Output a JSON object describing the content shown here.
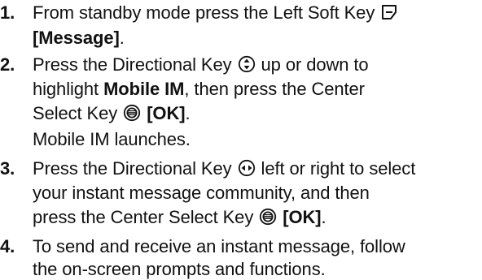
{
  "steps": [
    {
      "number": "1.",
      "line1_text": "From standby mode press the Left Soft Key",
      "line2_bold": "[Message]",
      "line2_text": "."
    },
    {
      "number": "2.",
      "line1_text": "Press the Directional Key",
      "line1_text_after": "up or down to",
      "line2_text": "highlight",
      "line2_bold": "Mobile IM",
      "line2_text_after": ", then press the Center",
      "line3_text": "Select Key",
      "line3_bold": "[OK]",
      "line3_text_after": ".",
      "note": "Mobile IM launches."
    },
    {
      "number": "3.",
      "line1_text": "Press the Directional Key",
      "line1_text_after": "left or right to select",
      "line2_text": "your instant message community, and then",
      "line3_text": "press the Center Select Key",
      "line3_bold": "[OK]",
      "line3_text_after": "."
    },
    {
      "number": "4.",
      "line1_text": "To send and receive an instant message, follow",
      "line2_text": "the on-screen prompts and functions."
    }
  ],
  "icons": {
    "left_soft_key": "left-soft-key-icon",
    "directional_up_down": "directional-key-up-down-icon",
    "center_select": "center-select-key-icon",
    "directional_left_right": "directional-key-left-right-icon"
  }
}
